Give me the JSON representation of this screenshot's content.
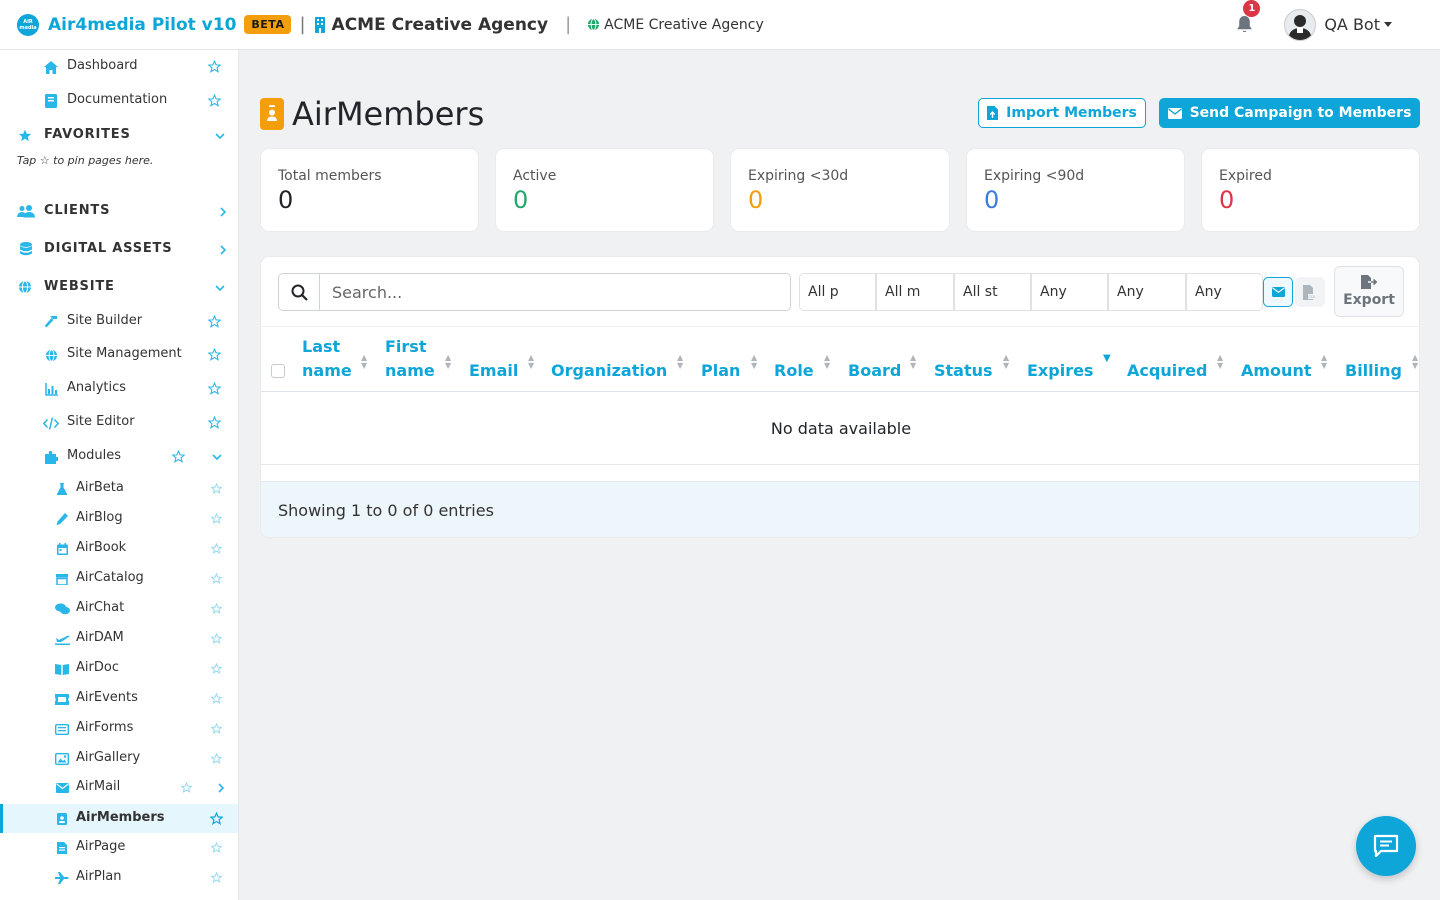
{
  "topbar": {
    "logo_text_top": "AIR",
    "logo_text_bottom": "media",
    "brand": "Air4media Pilot v10",
    "beta": "BETA",
    "separator": "|",
    "agency": "ACME Creative Agency",
    "site": "ACME Creative Agency",
    "notifications": "1",
    "user": "QA Bot",
    "icons": {
      "agency": "building-icon",
      "site": "globe-icon",
      "bell": "bell-icon"
    }
  },
  "sidebar": {
    "dashboard": "Dashboard",
    "documentation": "Documentation",
    "favorites": "FAVORITES",
    "favorites_hint": "Tap ☆ to pin pages here.",
    "clients": "CLIENTS",
    "digital_assets": "DIGITAL ASSETS",
    "website": "WEBSITE",
    "site_builder": "Site Builder",
    "site_management": "Site Management",
    "analytics": "Analytics",
    "site_editor": "Site Editor",
    "modules": "Modules",
    "modules_items": [
      "AirBeta",
      "AirBlog",
      "AirBook",
      "AirCatalog",
      "AirChat",
      "AirDAM",
      "AirDoc",
      "AirEvents",
      "AirForms",
      "AirGallery",
      "AirMail",
      "AirMembers",
      "AirPage",
      "AirPlan"
    ],
    "active_item": "AirMembers"
  },
  "main": {
    "title": "AirMembers",
    "import_button": "Import Members",
    "send_button": "Send Campaign to Members",
    "stats": [
      {
        "label": "Total members",
        "value": "0",
        "color": "#212529"
      },
      {
        "label": "Active",
        "value": "0",
        "color": "#20a86b"
      },
      {
        "label": "Expiring <30d",
        "value": "0",
        "color": "#f59e0b"
      },
      {
        "label": "Expiring <90d",
        "value": "0",
        "color": "#3b7ddd"
      },
      {
        "label": "Expired",
        "value": "0",
        "color": "#dc3545"
      }
    ],
    "search_placeholder": "Search...",
    "filters": [
      "All p",
      "All m",
      "All st",
      "Any",
      "Any",
      "Any"
    ],
    "export": "Export",
    "columns": [
      {
        "line1": "Last",
        "line2": "name"
      },
      {
        "line1": "First",
        "line2": "name"
      },
      {
        "line1": "",
        "line2": "Email"
      },
      {
        "line1": "",
        "line2": "Organization"
      },
      {
        "line1": "",
        "line2": "Plan"
      },
      {
        "line1": "",
        "line2": "Role"
      },
      {
        "line1": "",
        "line2": "Board"
      },
      {
        "line1": "",
        "line2": "Status"
      },
      {
        "line1": "",
        "line2": "Expires"
      },
      {
        "line1": "",
        "line2": "Acquired"
      },
      {
        "line1": "",
        "line2": "Amount"
      },
      {
        "line1": "",
        "line2": "Billing"
      }
    ],
    "sorted_column": "Expires",
    "empty": "No data available",
    "showing": "Showing 1 to 0 of 0 entries"
  },
  "colors": {
    "accent": "#0ea5d8",
    "beta": "#f59e0b",
    "title_icon": "#f59e0b",
    "badge": "#dc3545"
  }
}
